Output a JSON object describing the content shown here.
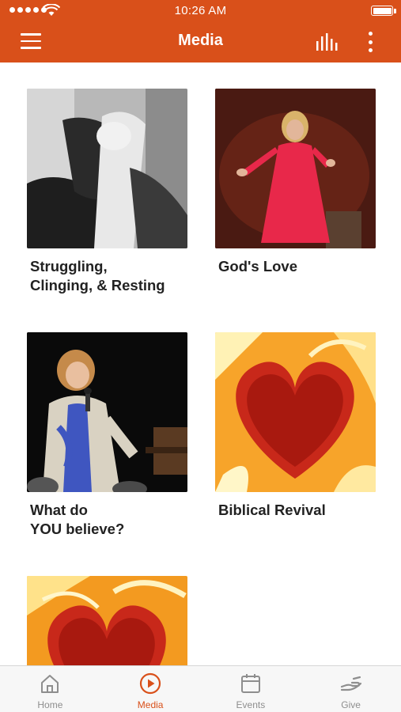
{
  "status_bar": {
    "time": "10:26 AM"
  },
  "header": {
    "title": "Media",
    "menu_icon": "hamburger-menu-icon",
    "bars_icon": "audio-bars-icon",
    "more_icon": "more-vertical-icon"
  },
  "colors": {
    "brand": "#d9501a",
    "tab_inactive": "#8e8e8e",
    "text": "#222222"
  },
  "media_items": [
    {
      "title": "Struggling,\nClinging, & Resting",
      "image": "clasped-hands-photo"
    },
    {
      "title": "God's Love",
      "image": "speaker-red-dress-photo"
    },
    {
      "title": "What do\nYOU believe?",
      "image": "speaker-microphone-photo"
    },
    {
      "title": "Biblical Revival",
      "image": "fire-heart-image"
    },
    {
      "title": "",
      "image": "fire-heart-image"
    }
  ],
  "tabs": [
    {
      "label": "Home",
      "icon": "home-icon",
      "active": false
    },
    {
      "label": "Media",
      "icon": "play-circle-icon",
      "active": true
    },
    {
      "label": "Events",
      "icon": "calendar-icon",
      "active": false
    },
    {
      "label": "Give",
      "icon": "give-hand-icon",
      "active": false
    }
  ]
}
